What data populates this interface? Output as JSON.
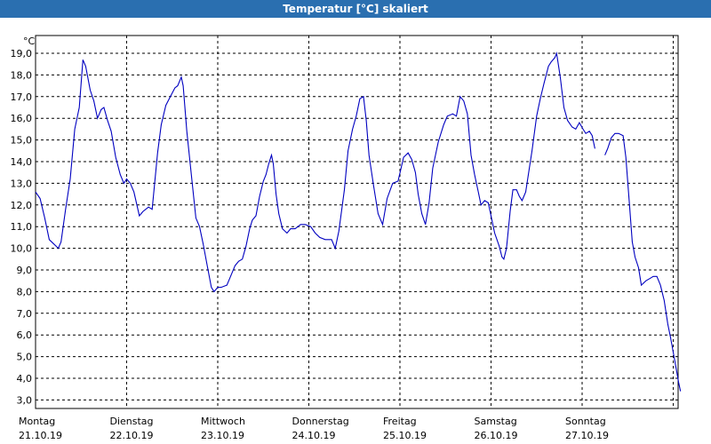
{
  "window": {
    "title": "Temperatur [°C] skaliert"
  },
  "chart_data": {
    "type": "line",
    "title": "Temperatur [°C] skaliert",
    "ylabel": "°C",
    "ylim": [
      3.0,
      19.0
    ],
    "y_ticks": [
      "19,0",
      "18,0",
      "17,0",
      "16,0",
      "15,0",
      "14,0",
      "13,0",
      "12,0",
      "11,0",
      "10,0",
      "9,0",
      "8,0",
      "7,0",
      "6,0",
      "5,0",
      "4,0",
      "3,0"
    ],
    "xlim": [
      0,
      7
    ],
    "x_ticks": [
      {
        "day": "Montag",
        "date": "21.10.19"
      },
      {
        "day": "Dienstag",
        "date": "22.10.19"
      },
      {
        "day": "Mittwoch",
        "date": "23.10.19"
      },
      {
        "day": "Donnerstag",
        "date": "24.10.19"
      },
      {
        "day": "Freitag",
        "date": "25.10.19"
      },
      {
        "day": "Samstag",
        "date": "26.10.19"
      },
      {
        "day": "Sonntag",
        "date": "27.10.19"
      }
    ],
    "grid": true,
    "line_color": "#0000c0",
    "series": [
      {
        "values": [
          [
            0.0,
            12.6
          ],
          [
            0.05,
            12.3
          ],
          [
            0.1,
            11.4
          ],
          [
            0.15,
            10.4
          ],
          [
            0.2,
            10.2
          ],
          [
            0.25,
            10.0
          ],
          [
            0.28,
            10.3
          ],
          [
            0.33,
            11.8
          ],
          [
            0.38,
            13.2
          ],
          [
            0.43,
            15.5
          ],
          [
            0.48,
            16.5
          ],
          [
            0.52,
            18.7
          ],
          [
            0.55,
            18.4
          ],
          [
            0.6,
            17.3
          ],
          [
            0.64,
            16.8
          ],
          [
            0.68,
            16.0
          ],
          [
            0.72,
            16.4
          ],
          [
            0.75,
            16.5
          ],
          [
            0.79,
            15.9
          ],
          [
            0.83,
            15.4
          ],
          [
            0.88,
            14.2
          ],
          [
            0.93,
            13.4
          ],
          [
            0.97,
            13.0
          ],
          [
            1.0,
            13.2
          ],
          [
            1.04,
            13.0
          ],
          [
            1.08,
            12.6
          ],
          [
            1.14,
            11.5
          ],
          [
            1.18,
            11.7
          ],
          [
            1.24,
            11.9
          ],
          [
            1.28,
            11.8
          ],
          [
            1.34,
            14.4
          ],
          [
            1.38,
            15.7
          ],
          [
            1.43,
            16.6
          ],
          [
            1.48,
            17.0
          ],
          [
            1.53,
            17.4
          ],
          [
            1.56,
            17.5
          ],
          [
            1.6,
            17.9
          ],
          [
            1.62,
            17.5
          ],
          [
            1.66,
            15.4
          ],
          [
            1.72,
            13.0
          ],
          [
            1.76,
            11.4
          ],
          [
            1.8,
            11.0
          ],
          [
            1.84,
            10.2
          ],
          [
            1.88,
            9.3
          ],
          [
            1.93,
            8.2
          ],
          [
            1.96,
            8.0
          ],
          [
            2.0,
            8.2
          ],
          [
            2.04,
            8.2
          ],
          [
            2.1,
            8.3
          ],
          [
            2.14,
            8.7
          ],
          [
            2.19,
            9.2
          ],
          [
            2.23,
            9.4
          ],
          [
            2.27,
            9.5
          ],
          [
            2.31,
            10.1
          ],
          [
            2.35,
            10.9
          ],
          [
            2.38,
            11.3
          ],
          [
            2.42,
            11.5
          ],
          [
            2.46,
            12.4
          ],
          [
            2.5,
            13.1
          ],
          [
            2.53,
            13.4
          ],
          [
            2.56,
            13.9
          ],
          [
            2.59,
            14.3
          ],
          [
            2.61,
            13.9
          ],
          [
            2.64,
            12.5
          ],
          [
            2.67,
            11.6
          ],
          [
            2.71,
            10.9
          ],
          [
            2.76,
            10.7
          ],
          [
            2.8,
            10.9
          ],
          [
            2.85,
            10.9
          ],
          [
            2.91,
            11.1
          ],
          [
            2.96,
            11.1
          ],
          [
            3.02,
            11.0
          ],
          [
            3.07,
            10.7
          ],
          [
            3.12,
            10.5
          ],
          [
            3.18,
            10.4
          ],
          [
            3.25,
            10.4
          ],
          [
            3.29,
            10.0
          ],
          [
            3.33,
            10.8
          ],
          [
            3.39,
            12.7
          ],
          [
            3.43,
            14.5
          ],
          [
            3.48,
            15.5
          ],
          [
            3.52,
            16.1
          ],
          [
            3.56,
            16.9
          ],
          [
            3.6,
            17.0
          ],
          [
            3.63,
            15.9
          ],
          [
            3.66,
            14.3
          ],
          [
            3.71,
            12.9
          ],
          [
            3.76,
            11.6
          ],
          [
            3.81,
            11.1
          ],
          [
            3.86,
            12.3
          ],
          [
            3.92,
            13.0
          ],
          [
            3.98,
            13.1
          ],
          [
            4.04,
            14.2
          ],
          [
            4.09,
            14.4
          ],
          [
            4.13,
            14.1
          ],
          [
            4.17,
            13.5
          ],
          [
            4.2,
            12.5
          ],
          [
            4.24,
            11.6
          ],
          [
            4.28,
            11.1
          ],
          [
            4.32,
            12.1
          ],
          [
            4.36,
            13.7
          ],
          [
            4.42,
            14.9
          ],
          [
            4.48,
            15.7
          ],
          [
            4.52,
            16.1
          ],
          [
            4.58,
            16.2
          ],
          [
            4.62,
            16.1
          ],
          [
            4.66,
            17.0
          ],
          [
            4.7,
            16.8
          ],
          [
            4.74,
            16.2
          ],
          [
            4.78,
            14.3
          ],
          [
            4.82,
            13.4
          ],
          [
            4.86,
            12.6
          ],
          [
            4.89,
            12.0
          ],
          [
            4.93,
            12.2
          ],
          [
            4.97,
            12.1
          ],
          [
            5.01,
            11.3
          ],
          [
            5.04,
            10.7
          ],
          [
            5.09,
            10.1
          ],
          [
            5.12,
            9.6
          ],
          [
            5.14,
            9.5
          ],
          [
            5.17,
            10.0
          ],
          [
            5.21,
            11.7
          ],
          [
            5.24,
            12.7
          ],
          [
            5.28,
            12.7
          ],
          [
            5.31,
            12.4
          ],
          [
            5.34,
            12.2
          ],
          [
            5.38,
            12.6
          ],
          [
            5.41,
            13.4
          ],
          [
            5.45,
            14.5
          ],
          [
            5.5,
            16.1
          ],
          [
            5.54,
            16.9
          ],
          [
            5.58,
            17.6
          ],
          [
            5.63,
            18.4
          ],
          [
            5.66,
            18.6
          ],
          [
            5.7,
            18.8
          ],
          [
            5.72,
            19.0
          ],
          [
            5.76,
            17.9
          ],
          [
            5.8,
            16.5
          ],
          [
            5.84,
            15.9
          ],
          [
            5.89,
            15.6
          ],
          [
            5.93,
            15.5
          ],
          [
            5.97,
            15.8
          ],
          [
            6.01,
            15.5
          ],
          [
            6.04,
            15.3
          ],
          [
            6.08,
            15.4
          ],
          [
            6.11,
            15.2
          ],
          [
            6.14,
            14.6
          ]
        ]
      },
      {
        "values": [
          [
            6.25,
            14.3
          ],
          [
            6.28,
            14.6
          ],
          [
            6.32,
            15.1
          ],
          [
            6.36,
            15.3
          ],
          [
            6.4,
            15.3
          ],
          [
            6.45,
            15.2
          ],
          [
            6.48,
            14.2
          ],
          [
            6.52,
            12.0
          ],
          [
            6.55,
            10.3
          ],
          [
            6.58,
            9.6
          ],
          [
            6.62,
            9.1
          ],
          [
            6.65,
            8.3
          ],
          [
            6.7,
            8.5
          ],
          [
            6.74,
            8.6
          ],
          [
            6.78,
            8.7
          ],
          [
            6.82,
            8.7
          ],
          [
            6.86,
            8.3
          ],
          [
            6.9,
            7.6
          ],
          [
            6.94,
            6.5
          ],
          [
            6.97,
            5.9
          ],
          [
            7.0,
            5.2
          ],
          [
            7.03,
            4.5
          ],
          [
            7.06,
            3.8
          ],
          [
            7.08,
            3.4
          ]
        ]
      }
    ]
  }
}
